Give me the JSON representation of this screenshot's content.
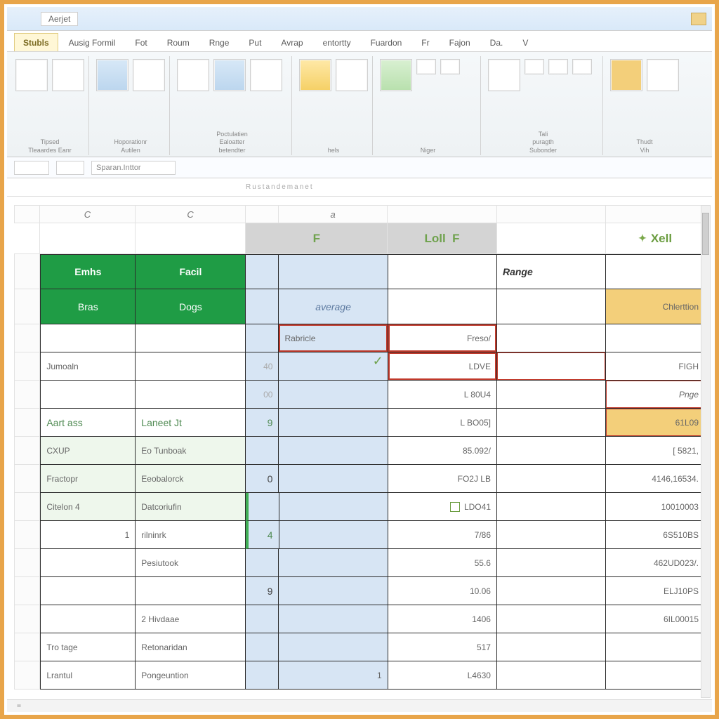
{
  "titlebar": {
    "doc_name": "Aerjet"
  },
  "ribbon_tabs": {
    "active": "Stubls",
    "items": [
      "Ausig Formil",
      "Fot",
      "Roum",
      "Rnge",
      "Put",
      "Avrap",
      "entortty",
      "Fuardon",
      "Fr",
      "Fajon",
      "Da.",
      "V"
    ]
  },
  "ribbon_groups": [
    {
      "labels": [
        "Tipsed",
        "Tleaardes Eanr"
      ]
    },
    {
      "labels": [
        "Hoporationr",
        "Autilen"
      ]
    },
    {
      "labels": [
        "Poctulatien",
        "Ealoatter",
        "betendter"
      ]
    },
    {
      "labels": [
        "hels"
      ]
    },
    {
      "labels": [
        "Niger"
      ]
    },
    {
      "labels": [
        "Tali",
        "puragth",
        "Subonder"
      ]
    },
    {
      "labels": [
        "Thudt",
        "Vih"
      ]
    }
  ],
  "namebox": {
    "value": ""
  },
  "fx_box": {
    "value": "Sparan.Inttor"
  },
  "formula_hint": "Rustandemanet",
  "col_headers": {
    "c1": "C",
    "c2": "C",
    "c3": "",
    "c4": "a",
    "c5": "",
    "c6": "",
    "c7": ""
  },
  "sec_headers": {
    "left_blank": "",
    "mid_f": "F",
    "mid_left": "Loll",
    "mid_f2": "F",
    "right": "Xell"
  },
  "table": {
    "header1": {
      "a": "Emhs",
      "b": "Facil"
    },
    "header2": {
      "a": "Bras",
      "b": "Dogs",
      "avg": "average",
      "range": "Range",
      "g": "Chlerttion"
    },
    "rows": [
      {
        "a": "",
        "b": "",
        "c": "",
        "d": "Rabricle",
        "e": "Freso/",
        "f": "",
        "g": ""
      },
      {
        "a": "Jumoaln",
        "b": "",
        "c": "40",
        "d": "",
        "e": "LDVE",
        "f": "",
        "g": "FIGH"
      },
      {
        "a": "",
        "b": "",
        "c": "00",
        "d": "",
        "e": "L 80U4",
        "f": "",
        "g": "Pnge"
      },
      {
        "a": "Aart ass",
        "b": "Laneet Jt",
        "c": "9",
        "d": "",
        "e": "L BO05]",
        "f": "",
        "g": "61L09"
      },
      {
        "a": "CXUP",
        "b": "Eo Tunboak",
        "c": "",
        "d": "",
        "e": "85.092/",
        "f": "",
        "g": "[ 5821,"
      },
      {
        "a": "Fractopr",
        "b": "Eeobalorck",
        "c": "0",
        "d": "",
        "e": "FO2J LB",
        "f": "",
        "g": "4146,16534."
      },
      {
        "a": "Citelon 4",
        "b": "Datcoriufin",
        "c": "",
        "d": "",
        "e": "LDO41",
        "f": "",
        "g": "10010003"
      },
      {
        "a": "1",
        "b": "rilninrk",
        "c": "4",
        "d": "",
        "e": "7/86",
        "f": "",
        "g": "6S510BS"
      },
      {
        "a": "",
        "b": "Pesiutook",
        "c": "",
        "d": "",
        "e": "55.6",
        "f": "",
        "g": "462UD023/."
      },
      {
        "a": "",
        "b": "",
        "c": "9",
        "d": "",
        "e": "10.06",
        "f": "",
        "g": "ELJ10PS"
      },
      {
        "a": "",
        "b": "2 Hivdaae",
        "c": "",
        "d": "",
        "e": "1406",
        "f": "",
        "g": "6IL00015"
      },
      {
        "a": "Tro tage",
        "b": "Retonaridan",
        "c": "",
        "d": "",
        "e": "517",
        "f": "",
        "g": ""
      },
      {
        "a": "Lrantul",
        "b": "Pongeuntion",
        "c": "",
        "d": "1",
        "e": "L4630",
        "f": "",
        "g": ""
      }
    ]
  },
  "status": {
    "eq": "="
  }
}
